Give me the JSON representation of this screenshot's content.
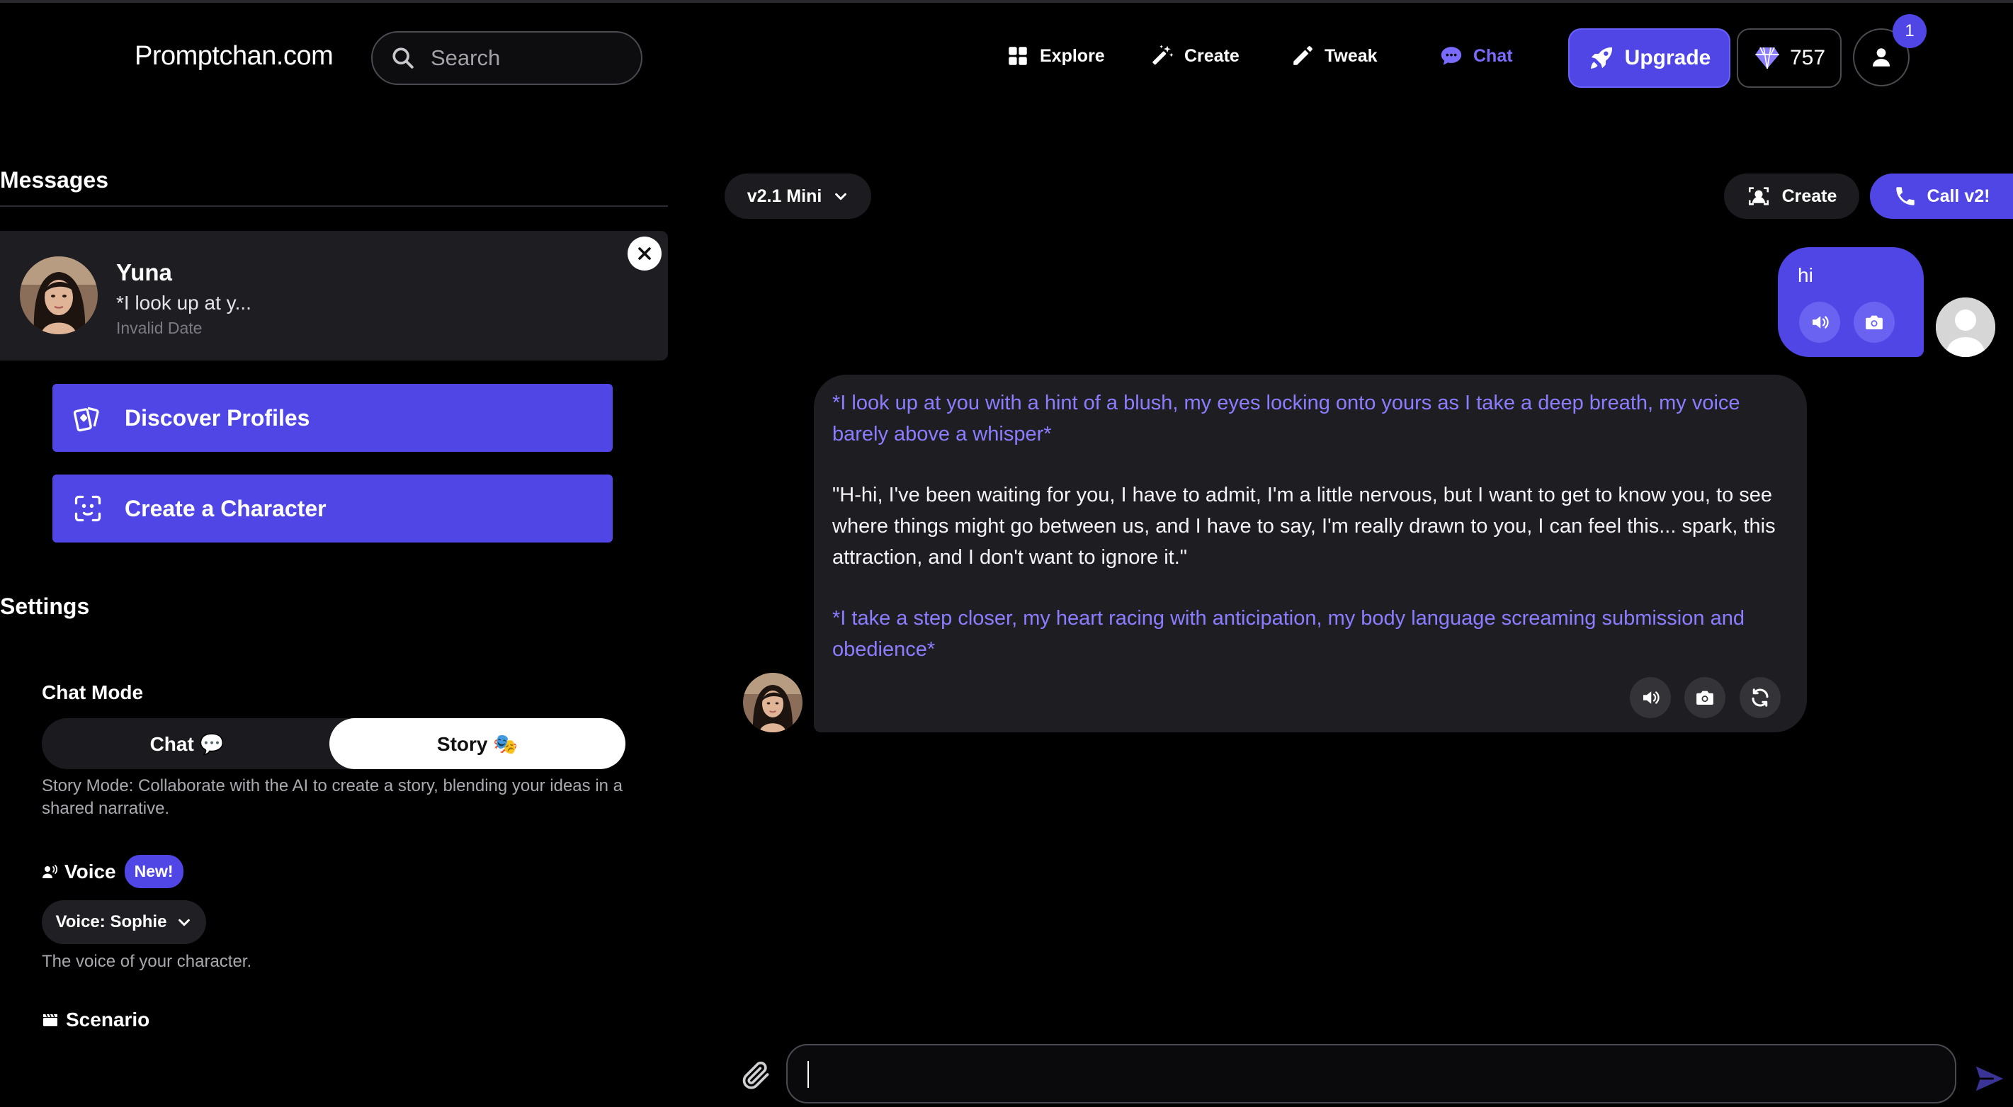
{
  "header": {
    "logo": "Promptchan.com",
    "search_placeholder": "Search",
    "nav": [
      {
        "label": "Explore",
        "icon": "grid-icon"
      },
      {
        "label": "Create",
        "icon": "magic-wand-icon"
      },
      {
        "label": "Tweak",
        "icon": "pencil-icon"
      },
      {
        "label": "Chat",
        "icon": "chat-bubble-icon"
      }
    ],
    "upgrade_label": "Upgrade",
    "gems_count": "757",
    "notification_count": "1"
  },
  "sidebar": {
    "messages_title": "Messages",
    "conversation": {
      "name": "Yuna",
      "preview": "*I look up at y...",
      "date": "Invalid Date"
    },
    "discover_label": "Discover Profiles",
    "create_character_label": "Create a Character",
    "settings_title": "Settings",
    "chat_mode": {
      "label": "Chat Mode",
      "options": [
        "Chat 💬",
        "Story 🎭"
      ],
      "selected": "Story 🎭",
      "description": "Story Mode: Collaborate with the AI to create a story, blending your ideas in a shared narrative."
    },
    "voice": {
      "label": "Voice",
      "badge": "New!",
      "selected": "Voice: Sophie",
      "description": "The voice of your character."
    },
    "scenario_label": "Scenario"
  },
  "chat": {
    "model_label": "v2.1 Mini",
    "create_label": "Create",
    "call_label": "Call v2!",
    "messages": [
      {
        "role": "user",
        "text": "hi"
      },
      {
        "role": "bot",
        "paragraphs": [
          {
            "type": "action",
            "text": "*I look up at you with a hint of a blush, my eyes locking onto yours as I take a deep breath, my voice barely above a whisper*"
          },
          {
            "type": "speech",
            "text": "\"H-hi, I've been waiting for you, I have to admit, I'm a little nervous, but I want to get to know you, to see where things might go between us, and I have to say, I'm really drawn to you, I can feel this... spark, this attraction, and I don't want to ignore it.\""
          },
          {
            "type": "action",
            "text": "*I take a step closer, my heart racing with anticipation, my body language screaming submission and obedience*"
          }
        ]
      }
    ],
    "input_value": ""
  },
  "colors": {
    "accent": "#4f46e5",
    "action_text": "#8b7dff",
    "bubble_bg": "#1e1e22"
  }
}
